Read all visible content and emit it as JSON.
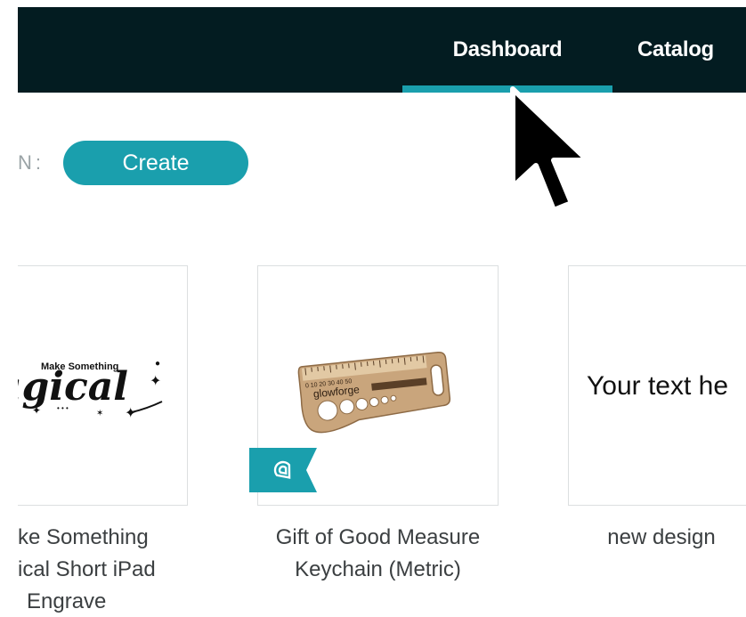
{
  "nav": {
    "tabs": [
      {
        "label": "Dashboard",
        "active": true
      },
      {
        "label": "Catalog",
        "active": false
      }
    ]
  },
  "toolbar": {
    "section_label": "N:",
    "create_label": "Create"
  },
  "colors": {
    "nav_bg": "#031c21",
    "accent": "#1a9fad",
    "text": "#3b3f41"
  },
  "designs": [
    {
      "caption_lines": [
        "ke Something",
        "ical Short iPad",
        "Engrave"
      ],
      "thumb_lines": [
        "Make Something",
        "agical"
      ]
    },
    {
      "caption": "Gift of Good Measure Keychain (Metric)",
      "thumb_text": "glowforge",
      "badge_icon": "catalog-ribbon-icon"
    },
    {
      "caption": "new design",
      "thumb_text": "Your text he"
    }
  ]
}
